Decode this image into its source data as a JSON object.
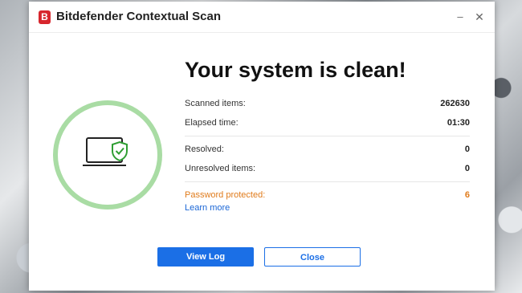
{
  "window": {
    "app_logo_letter": "B",
    "title": "Bitdefender Contextual Scan",
    "minimize_symbol": "–",
    "close_symbol": "✕"
  },
  "result": {
    "headline": "Your system is clean!",
    "icon": "laptop-shield-check-icon",
    "ring_color": "#a9dca4",
    "shield_color": "#2f9e33"
  },
  "stats": [
    {
      "label": "Scanned items:",
      "value": "262630"
    },
    {
      "label": "Elapsed time:",
      "value": "01:30"
    },
    {
      "label": "Resolved:",
      "value": "0"
    },
    {
      "label": "Unresolved items:",
      "value": "0"
    },
    {
      "label": "Password protected:",
      "value": "6",
      "color": "#e07b1b"
    }
  ],
  "learn_more": "Learn more",
  "buttons": {
    "view_log": "View Log",
    "close": "Close",
    "accent": "#1b6fe6"
  }
}
